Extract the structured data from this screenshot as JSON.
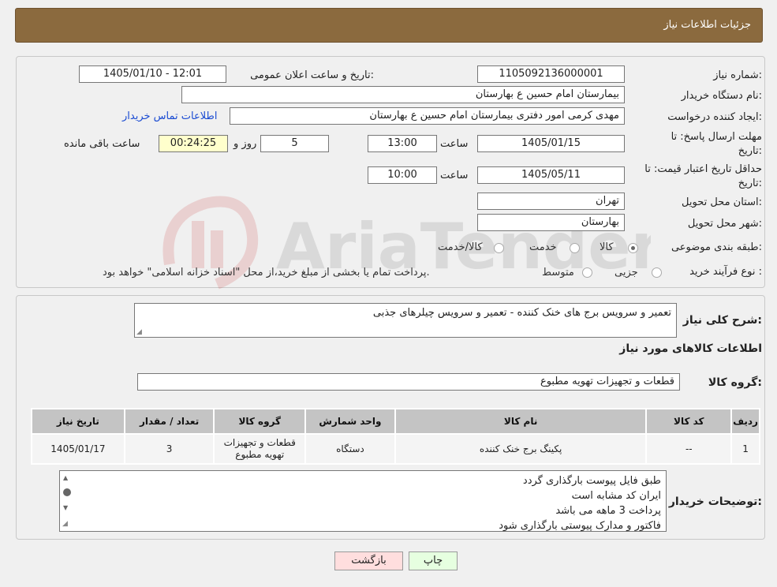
{
  "header": {
    "title": "جزئیات اطلاعات نیاز"
  },
  "form": {
    "need_number_label": "شماره نیاز:",
    "need_number": "1105092136000001",
    "announce_label": "تاریخ و ساعت اعلان عمومی:",
    "announce_value": "1405/01/10 - 12:01",
    "buyer_org_label": "نام دستگاه خریدار:",
    "buyer_org": "بیمارستان امام حسین  ع  بهارستان",
    "creator_label": "ایجاد کننده درخواست:",
    "creator": "مهدی کرمی امور دفتری بیمارستان امام حسین  ع  بهارستان",
    "contact_link": "اطلاعات تماس خریدار",
    "deadline_label_1": "مهلت ارسال پاسخ: تا",
    "deadline_label_2": "تاریخ:",
    "deadline_date": "1405/01/15",
    "time_label": "ساعت",
    "deadline_time": "13:00",
    "days_value": "5",
    "days_label": "روز و",
    "remaining_time": "00:24:25",
    "remaining_label": "ساعت باقی مانده",
    "validity_label_1": "حداقل تاریخ اعتبار قیمت: تا",
    "validity_label_2": "تاریخ:",
    "validity_date": "1405/05/11",
    "validity_time": "10:00",
    "province_label": "استان محل تحویل:",
    "province": "تهران",
    "city_label": "شهر محل تحویل:",
    "city": "بهارستان",
    "category_label": "طبقه بندی موضوعی:",
    "category_options": [
      "کالا",
      "خدمت",
      "کالا/خدمت"
    ],
    "category_selected": "کالا",
    "process_label": "نوع فرآیند خرید :",
    "process_options": [
      "جزیی",
      "متوسط"
    ],
    "process_note": "پرداخت تمام یا بخشی از مبلغ خرید،از محل \"اسناد خزانه اسلامی\" خواهد بود."
  },
  "summary": {
    "desc_label": "شرح کلی نیاز:",
    "desc_value": "تعمیر و سرویس برج های خنک کننده - تعمیر و سرویس چیلرهای جذبی",
    "goods_info_title": "اطلاعات کالاهای مورد نیاز",
    "group_label": "گروه کالا:",
    "group_value": "قطعات و تجهیزات تهویه مطبوع"
  },
  "table": {
    "headers": [
      "ردیف",
      "کد کالا",
      "نام کالا",
      "واحد شمارش",
      "گروه کالا",
      "تعداد / مقدار",
      "تاریخ نیاز"
    ],
    "rows": [
      [
        "1",
        "--",
        "پکینگ برج خنک کننده",
        "دستگاه",
        "قطعات و تجهیزات تهویه مطبوع",
        "3",
        "1405/01/17"
      ]
    ]
  },
  "buyer_notes": {
    "label": "توضیحات خریدار:",
    "lines": [
      "طبق فایل پیوست بارگذاری گردد",
      "ایران کد مشابه است",
      "پرداخت 3 ماهه می باشد",
      "فاکتور و مدارک پیوستی بارگذاری شود"
    ]
  },
  "buttons": {
    "print": "چاپ",
    "back": "بازگشت"
  },
  "colors": {
    "header_bg": "#8b6a3e",
    "link": "#1a4bd2",
    "back_btn": "#ffdede",
    "print_btn": "#e6ffe0"
  }
}
